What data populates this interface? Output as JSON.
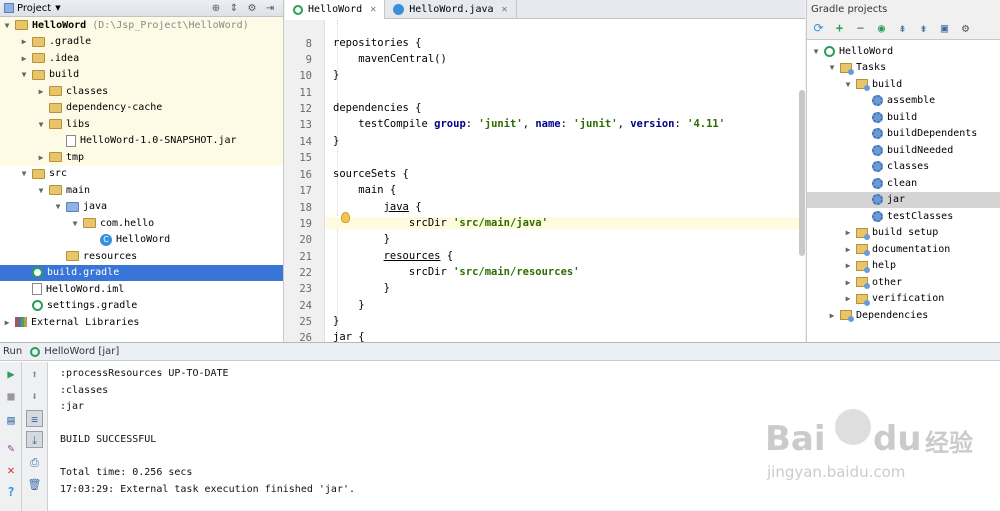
{
  "project_panel": {
    "title": "Project",
    "tree": [
      {
        "label": "HelloWord",
        "extra": "(D:\\Jsp_Project\\HelloWord)",
        "indent": 0,
        "arrow": "down",
        "icon": "project",
        "yellow": true
      },
      {
        "label": ".gradle",
        "indent": 1,
        "arrow": "right",
        "icon": "folder",
        "yellow": true
      },
      {
        "label": ".idea",
        "indent": 1,
        "arrow": "right",
        "icon": "folder",
        "yellow": true
      },
      {
        "label": "build",
        "indent": 1,
        "arrow": "down",
        "icon": "folder",
        "yellow": true
      },
      {
        "label": "classes",
        "indent": 2,
        "arrow": "right",
        "icon": "folder",
        "yellow": true
      },
      {
        "label": "dependency-cache",
        "indent": 2,
        "arrow": "",
        "icon": "folder",
        "yellow": true
      },
      {
        "label": "libs",
        "indent": 2,
        "arrow": "down",
        "icon": "folder",
        "yellow": true
      },
      {
        "label": "HelloWord-1.0-SNAPSHOT.jar",
        "indent": 3,
        "arrow": "",
        "icon": "file",
        "yellow": true
      },
      {
        "label": "tmp",
        "indent": 2,
        "arrow": "right",
        "icon": "folder",
        "yellow": true
      },
      {
        "label": "src",
        "indent": 1,
        "arrow": "down",
        "icon": "folder",
        "yellow": false
      },
      {
        "label": "main",
        "indent": 2,
        "arrow": "down",
        "icon": "folder",
        "yellow": false
      },
      {
        "label": "java",
        "indent": 3,
        "arrow": "down",
        "icon": "folder-src",
        "yellow": false
      },
      {
        "label": "com.hello",
        "indent": 4,
        "arrow": "down",
        "icon": "folder",
        "yellow": false
      },
      {
        "label": "HelloWord",
        "indent": 5,
        "arrow": "",
        "icon": "class",
        "yellow": false
      },
      {
        "label": "resources",
        "indent": 3,
        "arrow": "",
        "icon": "folder-res",
        "yellow": false
      },
      {
        "label": "build.gradle",
        "indent": 1,
        "arrow": "",
        "icon": "gradle",
        "selected": true
      },
      {
        "label": "HelloWord.iml",
        "indent": 1,
        "arrow": "",
        "icon": "file",
        "yellow": false
      },
      {
        "label": "settings.gradle",
        "indent": 1,
        "arrow": "",
        "icon": "gradle",
        "yellow": false
      },
      {
        "label": "External Libraries",
        "indent": 0,
        "arrow": "right",
        "icon": "lib",
        "yellow": false
      }
    ]
  },
  "editor": {
    "tabs": [
      {
        "label": "HelloWord",
        "active": true,
        "icon": "gradle"
      },
      {
        "label": "HelloWord.java",
        "active": false,
        "icon": "class"
      }
    ],
    "line_numbers": [
      "8",
      "9",
      "10",
      "11",
      "12",
      "13",
      "14",
      "15",
      "16",
      "17",
      "18",
      "19",
      "20",
      "21",
      "22",
      "23",
      "24",
      "25",
      "26"
    ],
    "current_line_index": 11
  },
  "gradle_panel": {
    "title": "Gradle projects",
    "tree": [
      {
        "label": "HelloWord",
        "indent": 0,
        "arrow": "down",
        "icon": "gradle"
      },
      {
        "label": "Tasks",
        "indent": 1,
        "arrow": "down",
        "icon": "task-folder"
      },
      {
        "label": "build",
        "indent": 2,
        "arrow": "down",
        "icon": "task-folder"
      },
      {
        "label": "assemble",
        "indent": 3,
        "arrow": "",
        "icon": "gear"
      },
      {
        "label": "build",
        "indent": 3,
        "arrow": "",
        "icon": "gear"
      },
      {
        "label": "buildDependents",
        "indent": 3,
        "arrow": "",
        "icon": "gear"
      },
      {
        "label": "buildNeeded",
        "indent": 3,
        "arrow": "",
        "icon": "gear"
      },
      {
        "label": "classes",
        "indent": 3,
        "arrow": "",
        "icon": "gear"
      },
      {
        "label": "clean",
        "indent": 3,
        "arrow": "",
        "icon": "gear"
      },
      {
        "label": "jar",
        "indent": 3,
        "arrow": "",
        "icon": "gear",
        "selected": true
      },
      {
        "label": "testClasses",
        "indent": 3,
        "arrow": "",
        "icon": "gear"
      },
      {
        "label": "build setup",
        "indent": 2,
        "arrow": "right",
        "icon": "task-folder"
      },
      {
        "label": "documentation",
        "indent": 2,
        "arrow": "right",
        "icon": "task-folder"
      },
      {
        "label": "help",
        "indent": 2,
        "arrow": "right",
        "icon": "task-folder"
      },
      {
        "label": "other",
        "indent": 2,
        "arrow": "right",
        "icon": "task-folder"
      },
      {
        "label": "verification",
        "indent": 2,
        "arrow": "right",
        "icon": "task-folder"
      },
      {
        "label": "Dependencies",
        "indent": 1,
        "arrow": "right",
        "icon": "task-folder"
      }
    ]
  },
  "run_panel": {
    "label": "Run",
    "config_name": "HelloWord [jar]",
    "console": [
      ":processResources UP-TO-DATE",
      ":classes",
      ":jar",
      "",
      "BUILD SUCCESSFUL",
      "",
      "Total time: 0.256 secs",
      "17:03:29: External task execution finished 'jar'."
    ]
  },
  "watermark": {
    "brand": "Bai",
    "brand2": "du",
    "cn": "经验",
    "url": "jingyan.baidu.com"
  },
  "colors": {
    "selection": "#3875d7",
    "gradle_green": "#2c9c5a",
    "string_green": "#2b6d00",
    "named_arg": "#00008b",
    "current_line": "#fffbde",
    "excluded_yellow": "#fdfbe6"
  }
}
